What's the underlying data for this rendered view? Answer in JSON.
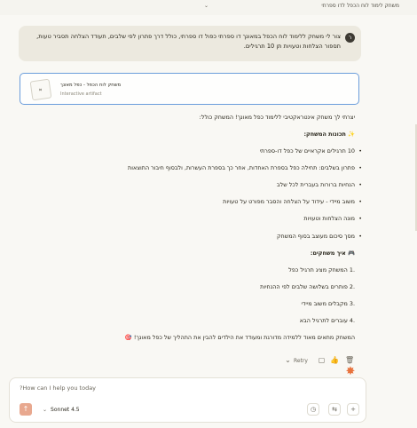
{
  "topbar": {
    "title": "משחק לימוד לוח הכפל לדו ספרתי",
    "chevron_icon": "chevron-down-icon"
  },
  "user_message": {
    "avatar_letter": "ר",
    "text": "צור לי משחק ללימוד לוח הכפל במאונך דו ספרתי כפול דו ספרתי, כולל דרך פתרון לפי שלבים, תעודד הצלחה תסביר טעות, תספור הצלחות וטעויות תן 10 תרגילים."
  },
  "artifact": {
    "title": "משחק לוח הכפל - כפל מאונך",
    "subtitle": "Interactive artifact",
    "icon": "code-icon"
  },
  "response": {
    "intro": "יצרתי לך משחק אינטראקטיבי ללימוד כפל מאונך! המשחק כולל:",
    "features_heading": "✨ תכונות המשחק:",
    "features": [
      "10 תרגילים אקראיים של כפל דו-ספרתי",
      "פתרון בשלבים: תחילה כפל בספרת האחדות, אחר כך בספרת העשרות, ולבסוף חיבור התוצאות",
      "הנחיות ברורות בעברית לכל שלב",
      "משוב מיידי - עידוד על הצלחה והסבר מפורט על טעויות",
      "מונה הצלחות וטעויות",
      "מסך סיכום מעוצב בסוף המשחק"
    ],
    "howto_heading": "🎮 איך משחקים:",
    "steps": [
      "המשחק מציג תרגיל כפל",
      "פותרים בשלושה שלבים לפי ההנחיות",
      "מקבלים משוב מיידי",
      "עוברים לתרגיל הבא"
    ],
    "closing": "המשחק מתאים מאוד ללמידה מדורגת ומעודד את הילדים להבין את התהליך של כפל מאונך! 🎯"
  },
  "actions": {
    "retry_label": "Retry",
    "icons": [
      "chevron-down-icon",
      "copy-icon",
      "thumbs-up-icon",
      "trash-icon"
    ]
  },
  "composer": {
    "placeholder": "?How can I help you today",
    "model_label": "Sonnet 4.5",
    "icons": [
      "upload-icon",
      "clock-icon",
      "sliders-icon",
      "plus-icon"
    ]
  },
  "colors": {
    "background": "#f9f8f4",
    "user_bubble": "#ece9df",
    "artifact_border": "#6b9ddb",
    "accent": "#e8733e"
  }
}
